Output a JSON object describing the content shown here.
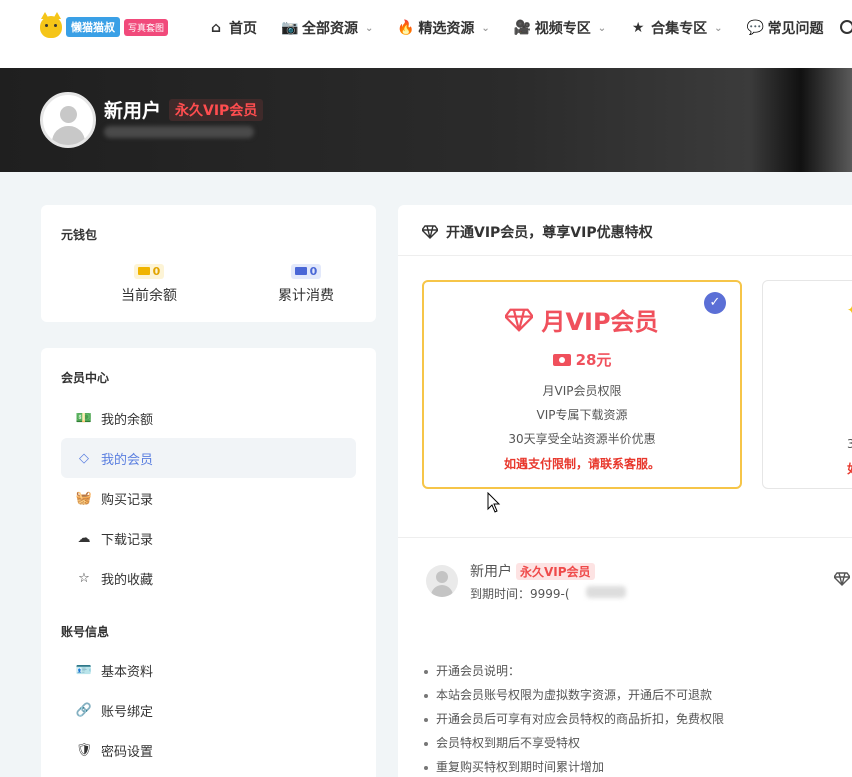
{
  "nav": {
    "logo_text": "懒猫猫叔",
    "logo_tag": "写真套图",
    "items": [
      {
        "label": "首页",
        "icon": "home-icon",
        "glyph": "⌂",
        "has_dropdown": false
      },
      {
        "label": "全部资源",
        "icon": "camera-icon",
        "glyph": "📷",
        "has_dropdown": true
      },
      {
        "label": "精选资源",
        "icon": "fire-icon",
        "glyph": "🔥",
        "has_dropdown": true
      },
      {
        "label": "视频专区",
        "icon": "video-icon",
        "glyph": "🎥",
        "has_dropdown": true
      },
      {
        "label": "合集专区",
        "icon": "star-icon",
        "glyph": "★",
        "has_dropdown": true
      },
      {
        "label": "常见问题",
        "icon": "comments-icon",
        "glyph": "💬",
        "has_dropdown": false
      }
    ]
  },
  "profile": {
    "name": "新用户",
    "vip_badge": "永久VIP会员"
  },
  "wallet": {
    "title": "元钱包",
    "balance_value": "0",
    "balance_label": "当前余额",
    "spent_value": "0",
    "spent_label": "累计消费"
  },
  "member_center": {
    "title": "会员中心",
    "items": [
      {
        "label": "我的余额",
        "icon": "money-icon",
        "glyph": "💵",
        "active": false
      },
      {
        "label": "我的会员",
        "icon": "diamond-icon",
        "glyph": "◇",
        "active": true
      },
      {
        "label": "购买记录",
        "icon": "basket-icon",
        "glyph": "🧺",
        "active": false
      },
      {
        "label": "下载记录",
        "icon": "cloud-download-icon",
        "glyph": "☁",
        "active": false
      },
      {
        "label": "我的收藏",
        "icon": "star-outline-icon",
        "glyph": "☆",
        "active": false
      }
    ]
  },
  "account": {
    "title": "账号信息",
    "items": [
      {
        "label": "基本资料",
        "icon": "id-card-icon",
        "glyph": "🪪"
      },
      {
        "label": "账号绑定",
        "icon": "user-bind-icon",
        "glyph": "🔗"
      },
      {
        "label": "密码设置",
        "icon": "shield-icon",
        "glyph": "🛡"
      }
    ]
  },
  "main": {
    "heading": "开通VIP会员，尊享VIP优惠特权",
    "plan": {
      "title": "月VIP会员",
      "price": "28元",
      "features": [
        "月VIP会员权限",
        "VIP专属下载资源",
        "30天享受全站资源半价优惠"
      ],
      "warning": "如遇支付限制，请联系客服。"
    },
    "plan2_partial": {
      "line1": "3",
      "line2": "如"
    },
    "user": {
      "name": "新用户",
      "vip_badge": "永久VIP会员",
      "expiry": "到期时间：9999-("
    },
    "notes": [
      "开通会员说明：",
      "本站会员账号权限为虚拟数字资源，开通后不可退款",
      "开通会员后可享有对应会员特权的商品折扣，免费权限",
      "会员特权到期后不享受特权",
      "重复购买特权到期时间累计增加"
    ]
  },
  "colors": {
    "accent": "#5b7fe0",
    "vip_red": "#f0505c",
    "gold": "#f6c548"
  }
}
